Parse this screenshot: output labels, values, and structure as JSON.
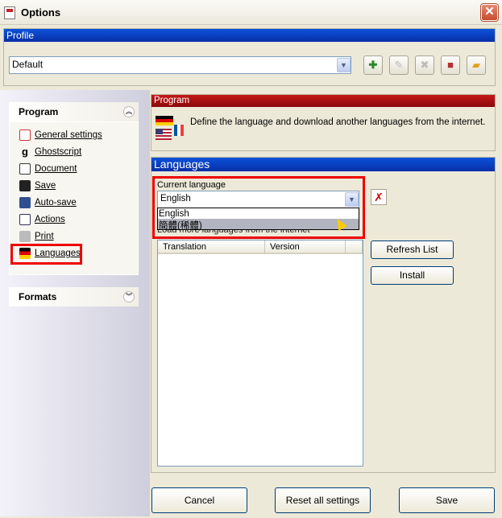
{
  "window": {
    "title": "Options",
    "close": "✕"
  },
  "profile": {
    "header": "Profile",
    "selected": "Default",
    "tools": [
      "add-profile-icon",
      "rename-profile-icon",
      "delete-profile-icon",
      "save-profile-icon",
      "open-profile-icon"
    ]
  },
  "nav": {
    "program_header": "Program",
    "items": [
      {
        "label": "General settings",
        "icon": "general-settings-icon"
      },
      {
        "label": "Ghostscript",
        "icon": "ghostscript-icon"
      },
      {
        "label": "Document",
        "icon": "document-icon"
      },
      {
        "label": "Save",
        "icon": "save-icon"
      },
      {
        "label": "Auto-save",
        "icon": "auto-save-icon"
      },
      {
        "label": "Actions",
        "icon": "actions-icon"
      },
      {
        "label": "Print",
        "icon": "print-icon"
      },
      {
        "label": "Languages",
        "icon": "languages-icon"
      }
    ],
    "formats_header": "Formats"
  },
  "program_section": {
    "header": "Program",
    "description": "Define the language and download another languages from the internet."
  },
  "languages": {
    "header": "Languages",
    "current_label": "Current language",
    "selected": "English",
    "options": [
      "English",
      "簡體(稀體)"
    ],
    "load_more": "Load more languages from the internet",
    "columns": [
      "Translation",
      "Version"
    ],
    "refresh_button": "Refresh List",
    "install_button": "Install"
  },
  "footer": {
    "cancel": "Cancel",
    "reset": "Reset all settings",
    "save": "Save"
  },
  "colors": {
    "title_blue": "#0a52d9",
    "section_red": "#c61818",
    "highlight_red": "#ee0000"
  }
}
